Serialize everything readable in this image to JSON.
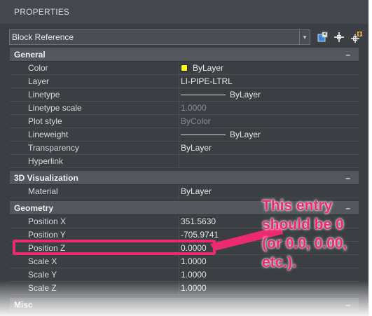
{
  "panel": {
    "title": "PROPERTIES"
  },
  "selector": {
    "value": "Block Reference"
  },
  "sections": {
    "general": {
      "title": "General",
      "rows": [
        {
          "label": "Color",
          "value": "ByLayer"
        },
        {
          "label": "Layer",
          "value": "LI-PIPE-LTRL"
        },
        {
          "label": "Linetype",
          "value": "ByLayer"
        },
        {
          "label": "Linetype scale",
          "value": "1.0000"
        },
        {
          "label": "Plot style",
          "value": "ByColor"
        },
        {
          "label": "Lineweight",
          "value": "ByLayer"
        },
        {
          "label": "Transparency",
          "value": "ByLayer"
        },
        {
          "label": "Hyperlink",
          "value": ""
        }
      ]
    },
    "visualization": {
      "title": "3D Visualization",
      "rows": [
        {
          "label": "Material",
          "value": "ByLayer"
        }
      ]
    },
    "geometry": {
      "title": "Geometry",
      "rows": [
        {
          "label": "Position X",
          "value": "351.5630"
        },
        {
          "label": "Position Y",
          "value": "-705.9741"
        },
        {
          "label": "Position Z",
          "value": "0.0000"
        },
        {
          "label": "Scale X",
          "value": "1.0000"
        },
        {
          "label": "Scale Y",
          "value": "1.0000"
        },
        {
          "label": "Scale Z",
          "value": "1.0000"
        }
      ]
    },
    "misc": {
      "title": "Misc"
    }
  },
  "annotation": {
    "text": "This entry\nshould be 0\n(or 0.0, 0.00,\netc.).",
    "color": "#ee2a6e"
  },
  "colors": {
    "color_swatch": "#ffff00"
  },
  "icons": [
    "dropdown-arrow-icon",
    "quick-select-icon",
    "select-objects-icon",
    "toggle-pickadd-icon",
    "collapse-minus-icon"
  ]
}
